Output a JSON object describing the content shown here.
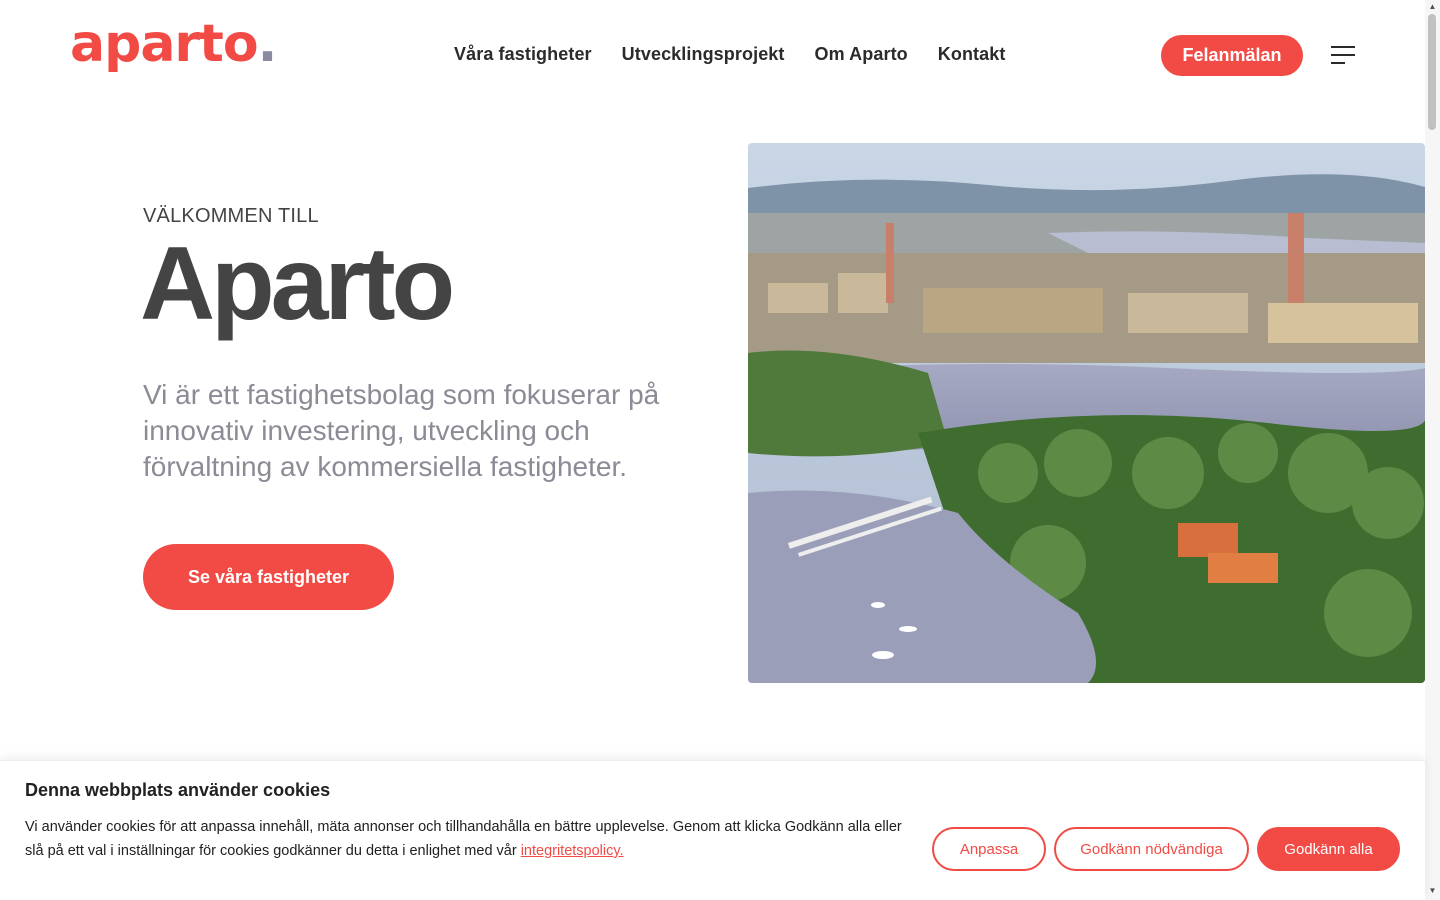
{
  "header": {
    "logo_text": "aparto",
    "logo_dot": ".",
    "nav": [
      {
        "label": "Våra fastigheter"
      },
      {
        "label": "Utvecklingsprojekt"
      },
      {
        "label": "Om Aparto"
      },
      {
        "label": "Kontakt"
      }
    ],
    "report_button": "Felanmälan",
    "menu_icon": "hamburger-menu-icon"
  },
  "hero": {
    "eyebrow": "VÄLKOMMEN TILL",
    "title": "Aparto",
    "text": "Vi är ett fastighetsbolag som fokuserar på innovativ investering, utveckling och förvaltning av kommersiella fastigheter.",
    "cta": "Se våra fastigheter"
  },
  "cookie": {
    "title": "Denna webbplats använder cookies",
    "text": "Vi använder cookies för att anpassa innehåll, mäta annonser och tillhandahålla en bättre upplevelse. Genom att klicka Godkänn alla eller slå på ett val i inställningar för cookies godkänner du detta i enlighet med vår",
    "link": "integritetspolicy.",
    "buttons": {
      "customize": "Anpassa",
      "necessary": "Godkänn nödvändiga",
      "accept": "Godkänn alla"
    }
  },
  "colors": {
    "accent": "#f24b45",
    "heading": "#444444",
    "muted": "#8b8b96",
    "logo_dot": "#8c8aa0"
  }
}
